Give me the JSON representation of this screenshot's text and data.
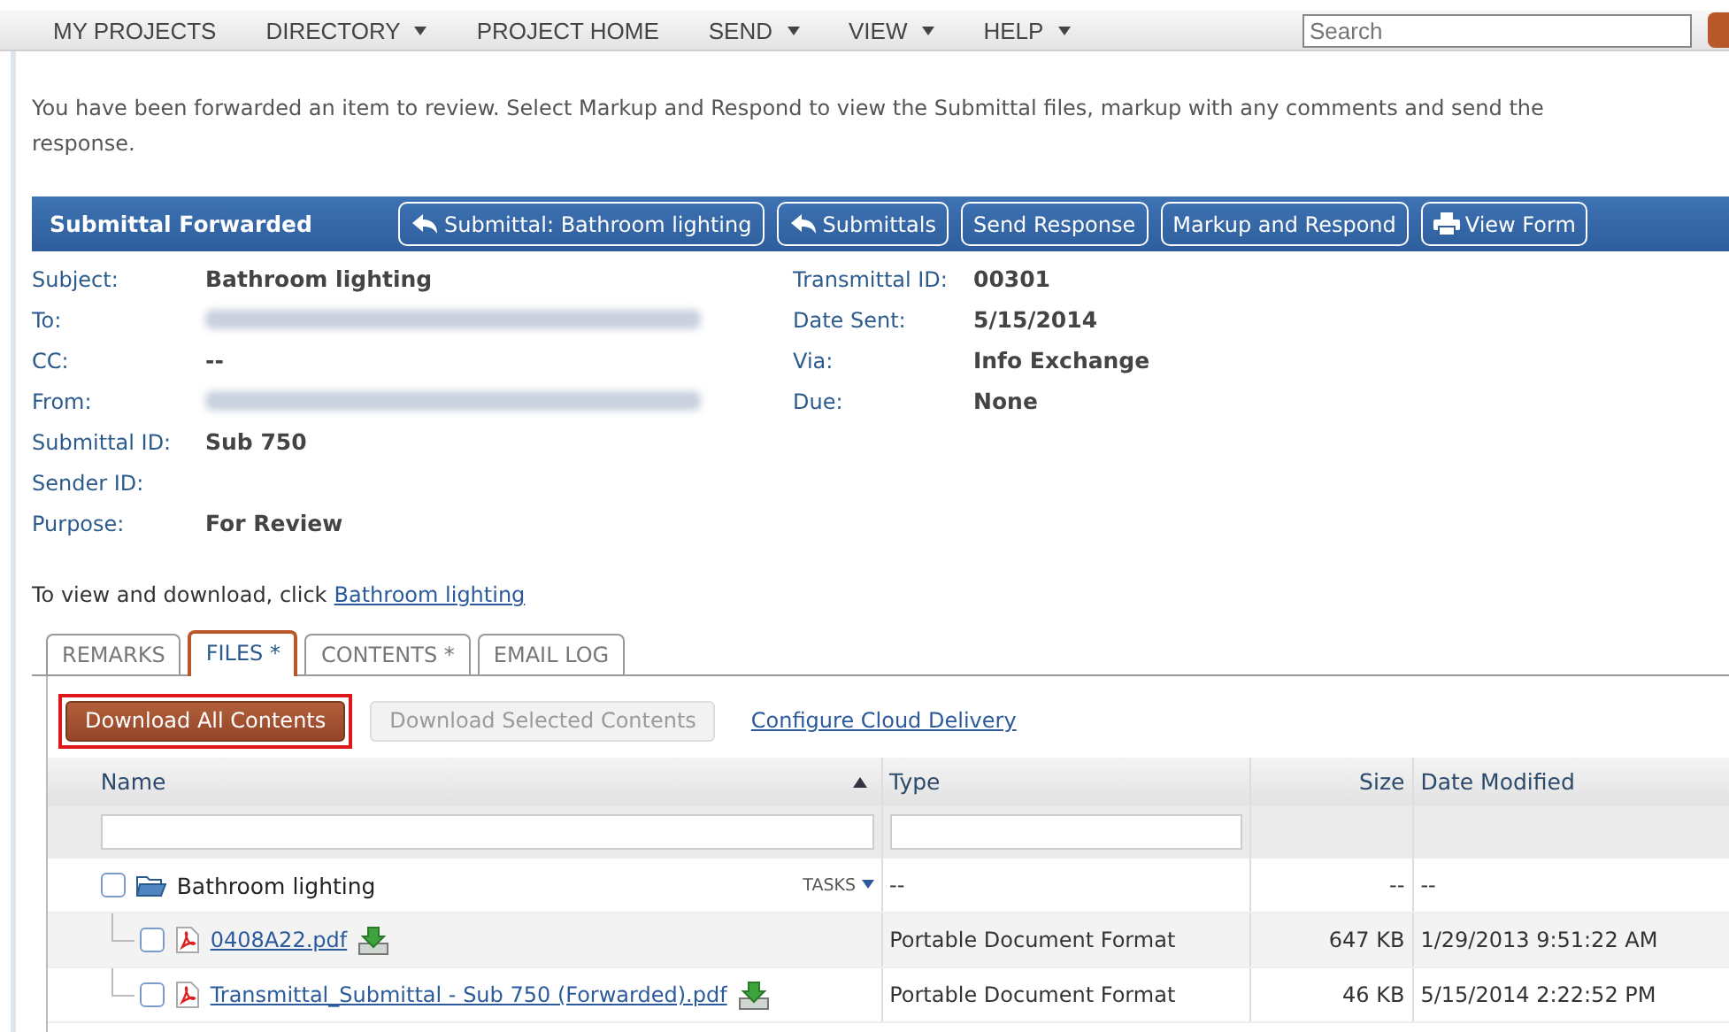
{
  "nav": {
    "items": [
      {
        "label": "MY PROJECTS",
        "dropdown": false
      },
      {
        "label": "DIRECTORY",
        "dropdown": true
      },
      {
        "label": "PROJECT HOME",
        "dropdown": false
      },
      {
        "label": "SEND",
        "dropdown": true
      },
      {
        "label": "VIEW",
        "dropdown": true
      },
      {
        "label": "HELP",
        "dropdown": true
      }
    ],
    "search": {
      "placeholder": "Search"
    }
  },
  "notice": "You have been forwarded an item to review. Select Markup and Respond to view the Submittal files, markup with any comments and send the response.",
  "panel": {
    "title": "Submittal Forwarded",
    "buttons": [
      {
        "label": "Submittal: Bathroom lighting",
        "kind": "back"
      },
      {
        "label": "Submittals",
        "kind": "back"
      },
      {
        "label": "Send Response",
        "kind": "plain"
      },
      {
        "label": "Markup and Respond",
        "kind": "plain"
      },
      {
        "label": "View Form",
        "kind": "print"
      }
    ],
    "fields_left": [
      {
        "label": "Subject:",
        "value": "Bathroom lighting",
        "redacted": false
      },
      {
        "label": "To:",
        "redacted": true
      },
      {
        "label": "CC:",
        "value": "--",
        "redacted": false
      },
      {
        "label": "From:",
        "redacted": true
      },
      {
        "label": "Submittal ID:",
        "value": "Sub 750",
        "redacted": false
      },
      {
        "label": "Sender ID:",
        "redacted": false
      },
      {
        "label": "Purpose:",
        "value": "For Review",
        "redacted": false
      }
    ],
    "fields_right": [
      {
        "label": "Transmittal ID:",
        "value": "00301"
      },
      {
        "label": "Date Sent:",
        "value": "5/15/2014"
      },
      {
        "label": "Via:",
        "value": "Info Exchange"
      },
      {
        "label": "Due:",
        "value": "None"
      }
    ]
  },
  "view_line": {
    "text": "To view and download, click",
    "link": "Bathroom lighting"
  },
  "tabs": [
    {
      "label": "REMARKS",
      "selected": false
    },
    {
      "label": "FILES *",
      "selected": true
    },
    {
      "label": "CONTENTS *",
      "selected": false
    },
    {
      "label": "EMAIL LOG",
      "selected": false
    }
  ],
  "actions": [
    {
      "label": "Download All Contents",
      "kind": "primary",
      "highlighted": true
    },
    {
      "label": "Download Selected Contents",
      "kind": "disabled",
      "highlighted": false
    },
    {
      "label": "Configure Cloud Delivery",
      "kind": "link",
      "highlighted": false
    }
  ],
  "table": {
    "columns": [
      {
        "label": "Name",
        "sorted": true
      },
      {
        "label": "Type",
        "sorted": false
      },
      {
        "label": "Size",
        "sorted": false
      },
      {
        "label": "Date Modified",
        "sorted": false
      }
    ],
    "rows": [
      {
        "kind": "folder",
        "name": "Bathroom lighting",
        "checked": false,
        "tasks": "TASKS",
        "type": "--",
        "size": "--",
        "date": "--",
        "children": [
          {
            "kind": "file",
            "name": "0408A22.pdf",
            "checked": false,
            "type": "Portable Document Format",
            "size": "647 KB",
            "date": "1/29/2013 9:51:22 AM"
          },
          {
            "kind": "file",
            "name": "Transmittal_Submittal - Sub 750 (Forwarded).pdf",
            "checked": false,
            "type": "Portable Document Format",
            "size": "46 KB",
            "date": "5/15/2014 2:22:52 PM"
          }
        ]
      }
    ]
  }
}
